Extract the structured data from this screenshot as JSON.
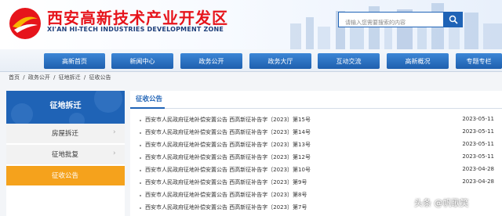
{
  "header": {
    "title": "西安高新技术产业开发区",
    "subtitle": "XI'AN HI-TECH INDUSTRIES DEVELOPMENT ZONE",
    "search_placeholder": "请输入您需要搜索的内容"
  },
  "nav": {
    "items": [
      {
        "label": "高新首页"
      },
      {
        "label": "新闻中心"
      },
      {
        "label": "政务公开"
      },
      {
        "label": "政务大厅"
      },
      {
        "label": "互动交流"
      },
      {
        "label": "高新概况"
      },
      {
        "label": "专题专栏"
      }
    ]
  },
  "breadcrumb": {
    "items": [
      "首页",
      "/",
      "政务公开",
      "/",
      "征地拆迁",
      "/",
      "征收公告"
    ]
  },
  "sidebar": {
    "title": "征地拆迁",
    "items": [
      {
        "label": "房屋拆迁",
        "chevron": "›"
      },
      {
        "label": "征地批复",
        "chevron": "›"
      },
      {
        "label": "征收公告",
        "active": true
      }
    ]
  },
  "main": {
    "tab_label": "征收公告",
    "articles": [
      {
        "title": "西安市人民政府征地补偿安置公告 西高新征补告字〔2023〕第15号",
        "date": "2023-05-11"
      },
      {
        "title": "西安市人民政府征地补偿安置公告 西高新征补告字〔2023〕第14号",
        "date": "2023-05-11"
      },
      {
        "title": "西安市人民政府征地补偿安置公告 西高新征补告字〔2023〕第13号",
        "date": "2023-05-11"
      },
      {
        "title": "西安市人民政府征地补偿安置公告 西高新征补告字〔2023〕第12号",
        "date": "2023-05-11"
      },
      {
        "title": "西安市人民政府征地补偿安置公告 西高新征补告字〔2023〕第10号",
        "date": "2023-04-28"
      },
      {
        "title": "西安市人民政府征地补偿安置公告 西高新征补告字〔2023〕第9号",
        "date": "2023-04-28"
      },
      {
        "title": "西安市人民政府征地补偿安置公告 西高新征补告字〔2023〕第8号",
        "date": ""
      },
      {
        "title": "西安市人民政府征地补偿安置公告 西高新征补告字〔2023〕第7号",
        "date": ""
      }
    ]
  },
  "watermark": "头条 @帆歌笑",
  "colors": {
    "brand_red": "#e6141b",
    "nav_blue": "#1f63b6",
    "active_orange": "#f5a21c"
  }
}
